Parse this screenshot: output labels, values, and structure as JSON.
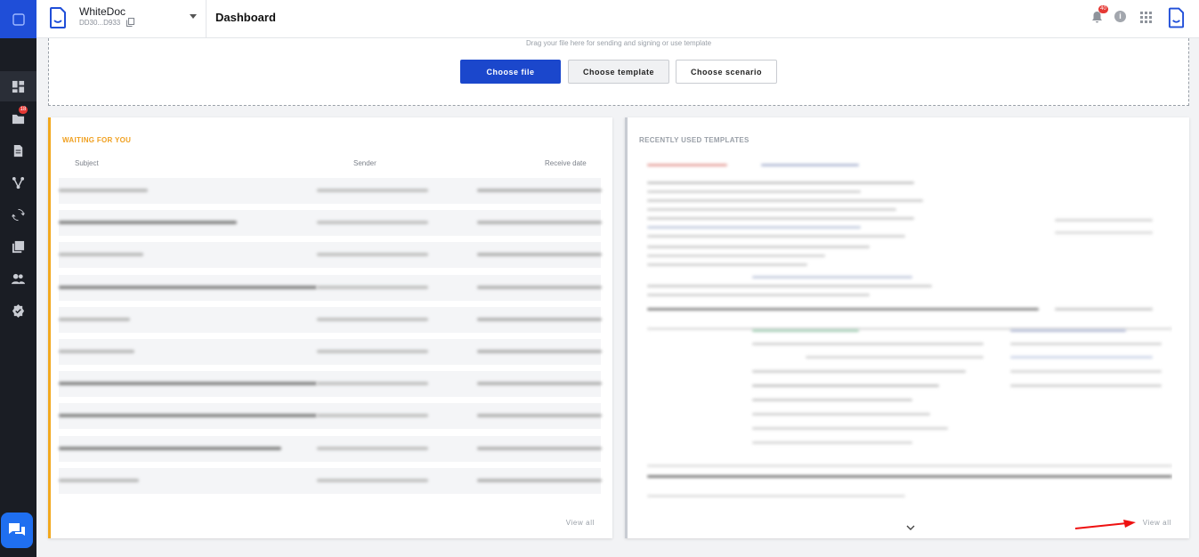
{
  "workspace": {
    "name": "WhiteDoc",
    "id": "DD30...D933"
  },
  "header": {
    "title": "Dashboard",
    "notifications_count": "40"
  },
  "sidebar": {
    "items": [
      {
        "icon": "dashboard-icon",
        "active": true
      },
      {
        "icon": "folder-icon",
        "badge": "18"
      },
      {
        "icon": "document-icon"
      },
      {
        "icon": "workflow-icon"
      },
      {
        "icon": "sync-icon"
      },
      {
        "icon": "library-icon"
      },
      {
        "icon": "contacts-icon"
      },
      {
        "icon": "settings-badge-icon"
      }
    ],
    "chat_icon": "chat-icon"
  },
  "dropzone": {
    "hint": "Drag your file here for sending and signing or use template",
    "choose_file": "Choose file",
    "choose_template": "Choose template",
    "choose_scenario": "Choose scenario"
  },
  "waiting": {
    "title": "WAITING FOR YOU",
    "columns": {
      "subject": "Subject",
      "sender": "Sender",
      "date": "Receive date"
    },
    "view_all": "View all"
  },
  "templates": {
    "title": "RECENTLY USED TEMPLATES",
    "view_all": "View all"
  },
  "colors": {
    "accent": "#1b47cc",
    "waiting": "#f2a81d",
    "sidebar": "#1a1d24"
  }
}
